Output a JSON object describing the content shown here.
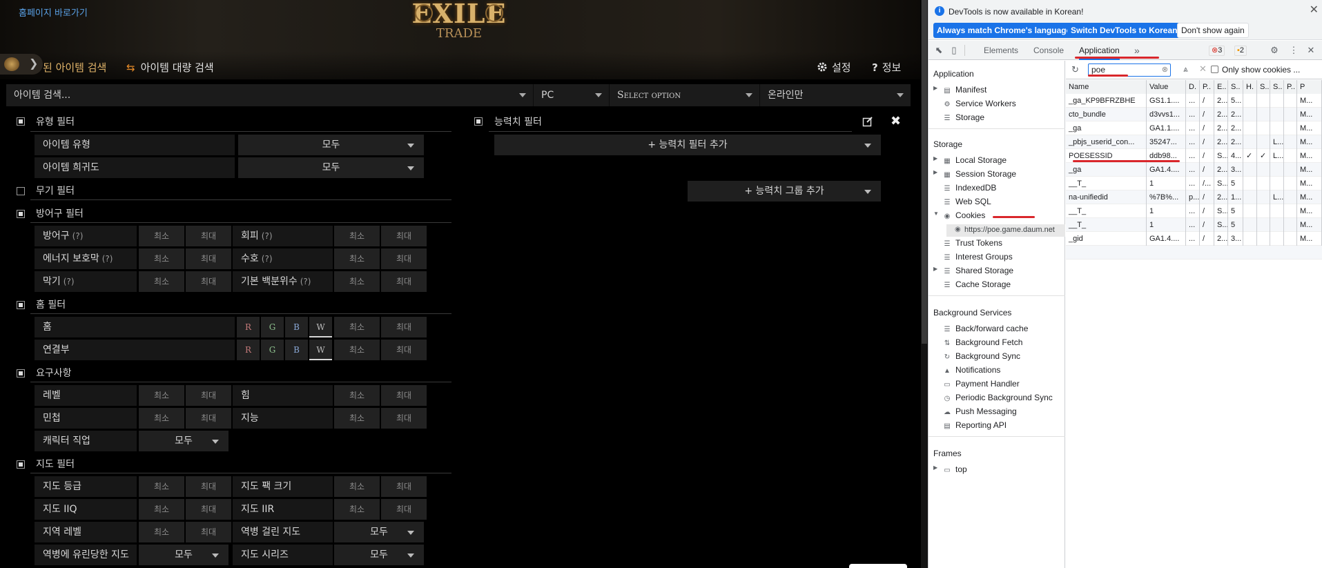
{
  "site": {
    "home_link": "홈페이지 바로가기",
    "logo": {
      "top": "EXILE",
      "bottom": "TRADE"
    },
    "tab_search": "된 아이템 검색",
    "tab_bulk": "아이템 대량 검색",
    "settings": "설정",
    "about": "정보",
    "search_placeholder": "아이템 검색...",
    "platform": "PC",
    "league": "Select option",
    "online": "온라인만",
    "type_filter": {
      "title": "유형 필터",
      "item_type_label": "아이템 유형",
      "item_type_value": "모두",
      "rarity_label": "아이템 희귀도",
      "rarity_value": "모두"
    },
    "weapon_filter": {
      "title": "무기 필터"
    },
    "armour_filter": {
      "title": "방어구 필터",
      "armour": "방어구",
      "evasion": "회피",
      "es": "에너지 보호막",
      "ward": "수호",
      "block": "막기",
      "base_pct": "기본 백분위수",
      "q": "(?)"
    },
    "socket_filter": {
      "title": "홈 필터",
      "sockets": "홈",
      "links": "연결부",
      "r": "R",
      "g": "G",
      "b": "B",
      "w": "W"
    },
    "req_filter": {
      "title": "요구사항",
      "level": "레벨",
      "str": "힘",
      "dex": "민첩",
      "int": "지능",
      "class": "캐릭터 직업",
      "class_value": "모두"
    },
    "map_filter": {
      "title": "지도 필터",
      "tier": "지도 등급",
      "pack": "지도 팩 크기",
      "iiq": "지도 IIQ",
      "iir": "지도 IIR",
      "area_level": "지역 레벨",
      "blighted": "역병 걸린 지도",
      "blight_ravaged": "역병에 유린당한 지도",
      "series": "지도 시리즈",
      "all": "모두"
    },
    "min": "최소",
    "max": "최대",
    "stat_filter": {
      "title": "능력치 필터",
      "add": "+ 능력치 필터 추가",
      "add_group": "+ 능력치 그룹 추가"
    }
  },
  "devtools": {
    "banner_msg": "DevTools is now available in Korean!",
    "btn_match": "Always match Chrome's language",
    "btn_switch": "Switch DevTools to Korean",
    "btn_dont": "Don't show again",
    "tabs": [
      "Elements",
      "Console",
      "Application"
    ],
    "more": "»",
    "errors": "3",
    "warnings": "2",
    "filter_value": "poe",
    "only_show": "Only show cookies ...",
    "tree": {
      "app_header": "Application",
      "app_items": [
        "Manifest",
        "Service Workers",
        "Storage"
      ],
      "storage_header": "Storage",
      "storage_items": [
        "Local Storage",
        "Session Storage",
        "IndexedDB",
        "Web SQL",
        "Cookies"
      ],
      "cookie_host": "https://poe.game.daum.net",
      "storage_items2": [
        "Trust Tokens",
        "Interest Groups",
        "Shared Storage",
        "Cache Storage"
      ],
      "bg_header": "Background Services",
      "bg_items": [
        "Back/forward cache",
        "Background Fetch",
        "Background Sync",
        "Notifications",
        "Payment Handler",
        "Periodic Background Sync",
        "Push Messaging",
        "Reporting API"
      ],
      "frames_header": "Frames",
      "frames_items": [
        "top"
      ]
    },
    "columns": [
      "Name",
      "Value",
      "D.",
      "P..",
      "E..",
      "S..",
      "H.",
      "S..",
      "S..",
      "P..",
      "P"
    ],
    "rows": [
      [
        "_ga_KP9BFRZBHE",
        "GS1.1....",
        "...",
        "/",
        "2...",
        "5...",
        "",
        "",
        "",
        "",
        "M..."
      ],
      [
        "cto_bundle",
        "d3vvs1...",
        "...",
        "/",
        "2...",
        "2...",
        "",
        "",
        "",
        "",
        "M..."
      ],
      [
        "_ga",
        "GA1.1....",
        "...",
        "/",
        "2...",
        "2...",
        "",
        "",
        "",
        "",
        "M..."
      ],
      [
        "_pbjs_userid_con...",
        "35247...",
        "...",
        "/",
        "2...",
        "2...",
        "",
        "",
        "L...",
        "",
        "M..."
      ],
      [
        "POESESSID",
        "ddb98...",
        "...",
        "/",
        "S...",
        "4...",
        "✓",
        "✓",
        "L...",
        "",
        "M..."
      ],
      [
        "_ga",
        "GA1.4....",
        "...",
        "/",
        "2...",
        "3...",
        "",
        "",
        "",
        "",
        "M..."
      ],
      [
        "__T_",
        "1",
        "...",
        "/...",
        "S...",
        "5",
        "",
        "",
        "",
        "",
        "M..."
      ],
      [
        "na-unifiedid",
        "%7B%...",
        "p...",
        "/",
        "2...",
        "1...",
        "",
        "",
        "L...",
        "",
        "M..."
      ],
      [
        "__T_",
        "1",
        "...",
        "/",
        "S...",
        "5",
        "",
        "",
        "",
        "",
        "M..."
      ],
      [
        "__T_",
        "1",
        "...",
        "/",
        "S...",
        "5",
        "",
        "",
        "",
        "",
        "M..."
      ],
      [
        "_gid",
        "GA1.4....",
        "...",
        "/",
        "2...",
        "3...",
        "",
        "",
        "",
        "",
        "M..."
      ]
    ]
  }
}
